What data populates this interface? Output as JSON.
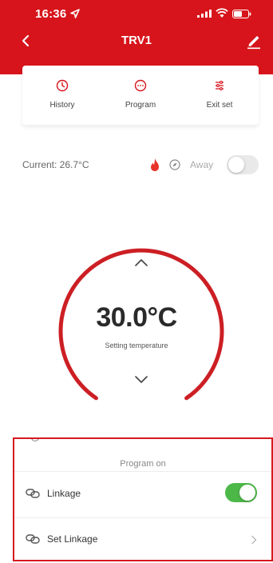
{
  "status": {
    "time": "16:36"
  },
  "nav": {
    "title": "TRV1"
  },
  "actions": [
    {
      "label": "History"
    },
    {
      "label": "Program"
    },
    {
      "label": "Exit set"
    }
  ],
  "current": {
    "text": "Current: 26.7°C",
    "away_label": "Away",
    "away_on": false
  },
  "dial": {
    "temperature": "30.0°C",
    "subtitle": "Setting temperature"
  },
  "panel": {
    "program_status": "Program on",
    "linkage_label": "Linkage",
    "linkage_on": true,
    "set_linkage_label": "Set Linkage"
  },
  "colors": {
    "brand": "#d7141b",
    "toggle_on": "#4cb848",
    "toggle_off": "#e9e9e9"
  },
  "icons": [
    "back-arrow-icon",
    "edit-icon",
    "history-clock-icon",
    "program-dots-icon",
    "exit-set-icon",
    "flame-icon",
    "compass-icon",
    "chevron-up-icon",
    "chevron-down-icon",
    "link-icon",
    "chevron-right-icon"
  ]
}
